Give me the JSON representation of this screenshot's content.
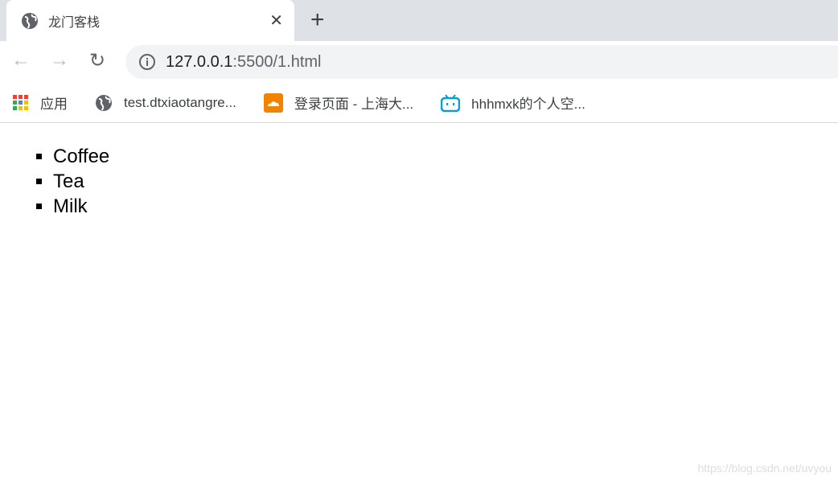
{
  "tab": {
    "title": "龙门客栈",
    "icon": "globe-icon",
    "close": "✕",
    "new": "+"
  },
  "toolbar": {
    "back": "←",
    "forward": "→",
    "reload": "↻",
    "url_host": "127.0.0.1",
    "url_rest": ":5500/1.html"
  },
  "bookmarks": [
    {
      "label": "应用",
      "icon": "apps-grid-icon"
    },
    {
      "label": "test.dtxiaotangre...",
      "icon": "globe-icon"
    },
    {
      "label": "登录页面 - 上海大...",
      "icon": "orange-cloud-icon"
    },
    {
      "label": "hhhmxk的个人空...",
      "icon": "bilibili-icon"
    }
  ],
  "content": {
    "items": [
      "Coffee",
      "Tea",
      "Milk"
    ]
  },
  "watermark": "https://blog.csdn.net/uvyou"
}
